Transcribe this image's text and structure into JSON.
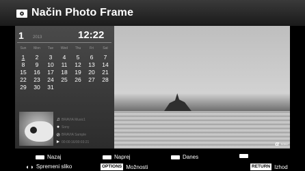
{
  "header": {
    "title": "Način Photo Frame",
    "icon": "photo-frame-icon"
  },
  "calendar": {
    "day": "1",
    "year": "2013",
    "time": "12:22",
    "weekdays": [
      "Sun",
      "Mon",
      "Tue",
      "Wed",
      "Thu",
      "Fri",
      "Sat"
    ],
    "weeks": [
      [
        "1",
        "2",
        "3",
        "4",
        "5",
        "6",
        "7"
      ],
      [
        "8",
        "9",
        "10",
        "11",
        "12",
        "13",
        "14"
      ],
      [
        "15",
        "16",
        "17",
        "18",
        "19",
        "20",
        "21"
      ],
      [
        "22",
        "23",
        "24",
        "25",
        "26",
        "27",
        "28"
      ],
      [
        "29",
        "30",
        "31",
        "",
        "",
        "",
        ""
      ]
    ]
  },
  "music": {
    "track": "BRAVIA Music1",
    "artist": "Sony",
    "album": "BRAVIA Sample",
    "progress": "00:00:16/00:03:21"
  },
  "photo": {
    "mark": "α",
    "sub": "SONY"
  },
  "footer": {
    "back": "Nazaj",
    "forward": "Naprej",
    "today": "Danes",
    "change": "Spremeni sliko",
    "options_key": "OPTIONS",
    "options": "Možnosti",
    "return_key": "RETURN",
    "exit": "Izhod"
  },
  "colors": {
    "background": "#000000",
    "panel": "#333333",
    "text": "#ffffff"
  }
}
